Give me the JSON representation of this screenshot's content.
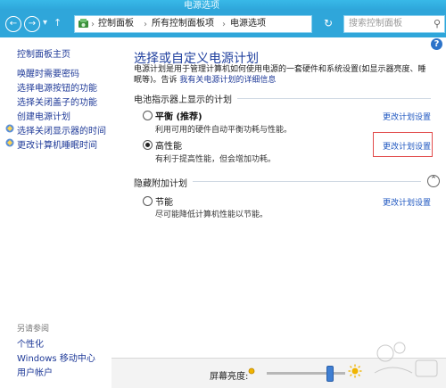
{
  "window": {
    "title": "电源选项"
  },
  "toolbar": {
    "back_icon": "back-arrow-icon",
    "forward_icon": "forward-arrow-icon",
    "recent_icon": "chevron-down-icon",
    "up_icon": "up-arrow-icon",
    "breadcrumb": [
      "控制面板",
      "所有控制面板项",
      "电源选项"
    ],
    "search_placeholder": "搜索控制面板",
    "refresh_icon": "refresh-icon"
  },
  "left_pane": {
    "items": [
      {
        "label": "控制面板主页"
      },
      {
        "label": "唤醒时需要密码"
      },
      {
        "label": "选择电源按钮的功能"
      },
      {
        "label": "选择关闭盖子的功能"
      },
      {
        "label": "创建电源计划"
      },
      {
        "label": "选择关闭显示器的时间"
      },
      {
        "label": "更改计算机睡眠时间"
      }
    ],
    "see_also_title": "另请参阅",
    "see_also": [
      {
        "label": "个性化"
      },
      {
        "label": "Windows 移动中心"
      },
      {
        "label": "用户帐户"
      }
    ]
  },
  "main": {
    "title": "选择或自定义电源计划",
    "desc_line1": "电源计划是用于管理计算机如何使用电源的一套硬件和系统设置(如显示器亮度、睡眠等)。告诉",
    "desc_link": "我有关电源计划的详细信息",
    "battery_section": "电池指示器上显示的计划",
    "plans": [
      {
        "name": "平衡 (推荐)",
        "desc": "利用可用的硬件自动平衡功耗与性能。",
        "link": "更改计划设置"
      },
      {
        "name": "高性能",
        "desc": "有利于提高性能，但会增加功耗。",
        "link": "更改计划设置"
      }
    ],
    "hidden_section": "隐藏附加计划",
    "hidden_plans": [
      {
        "name": "节能",
        "desc": "尽可能降低计算机性能以节能。",
        "link": "更改计划设置"
      }
    ]
  },
  "bottom": {
    "brightness_label": "屏幕亮度:",
    "brightness_level": 0.8
  },
  "colors": {
    "titlebar": "#2fa6da",
    "link": "#1f3a98",
    "highlight_border": "#e24b4b"
  }
}
